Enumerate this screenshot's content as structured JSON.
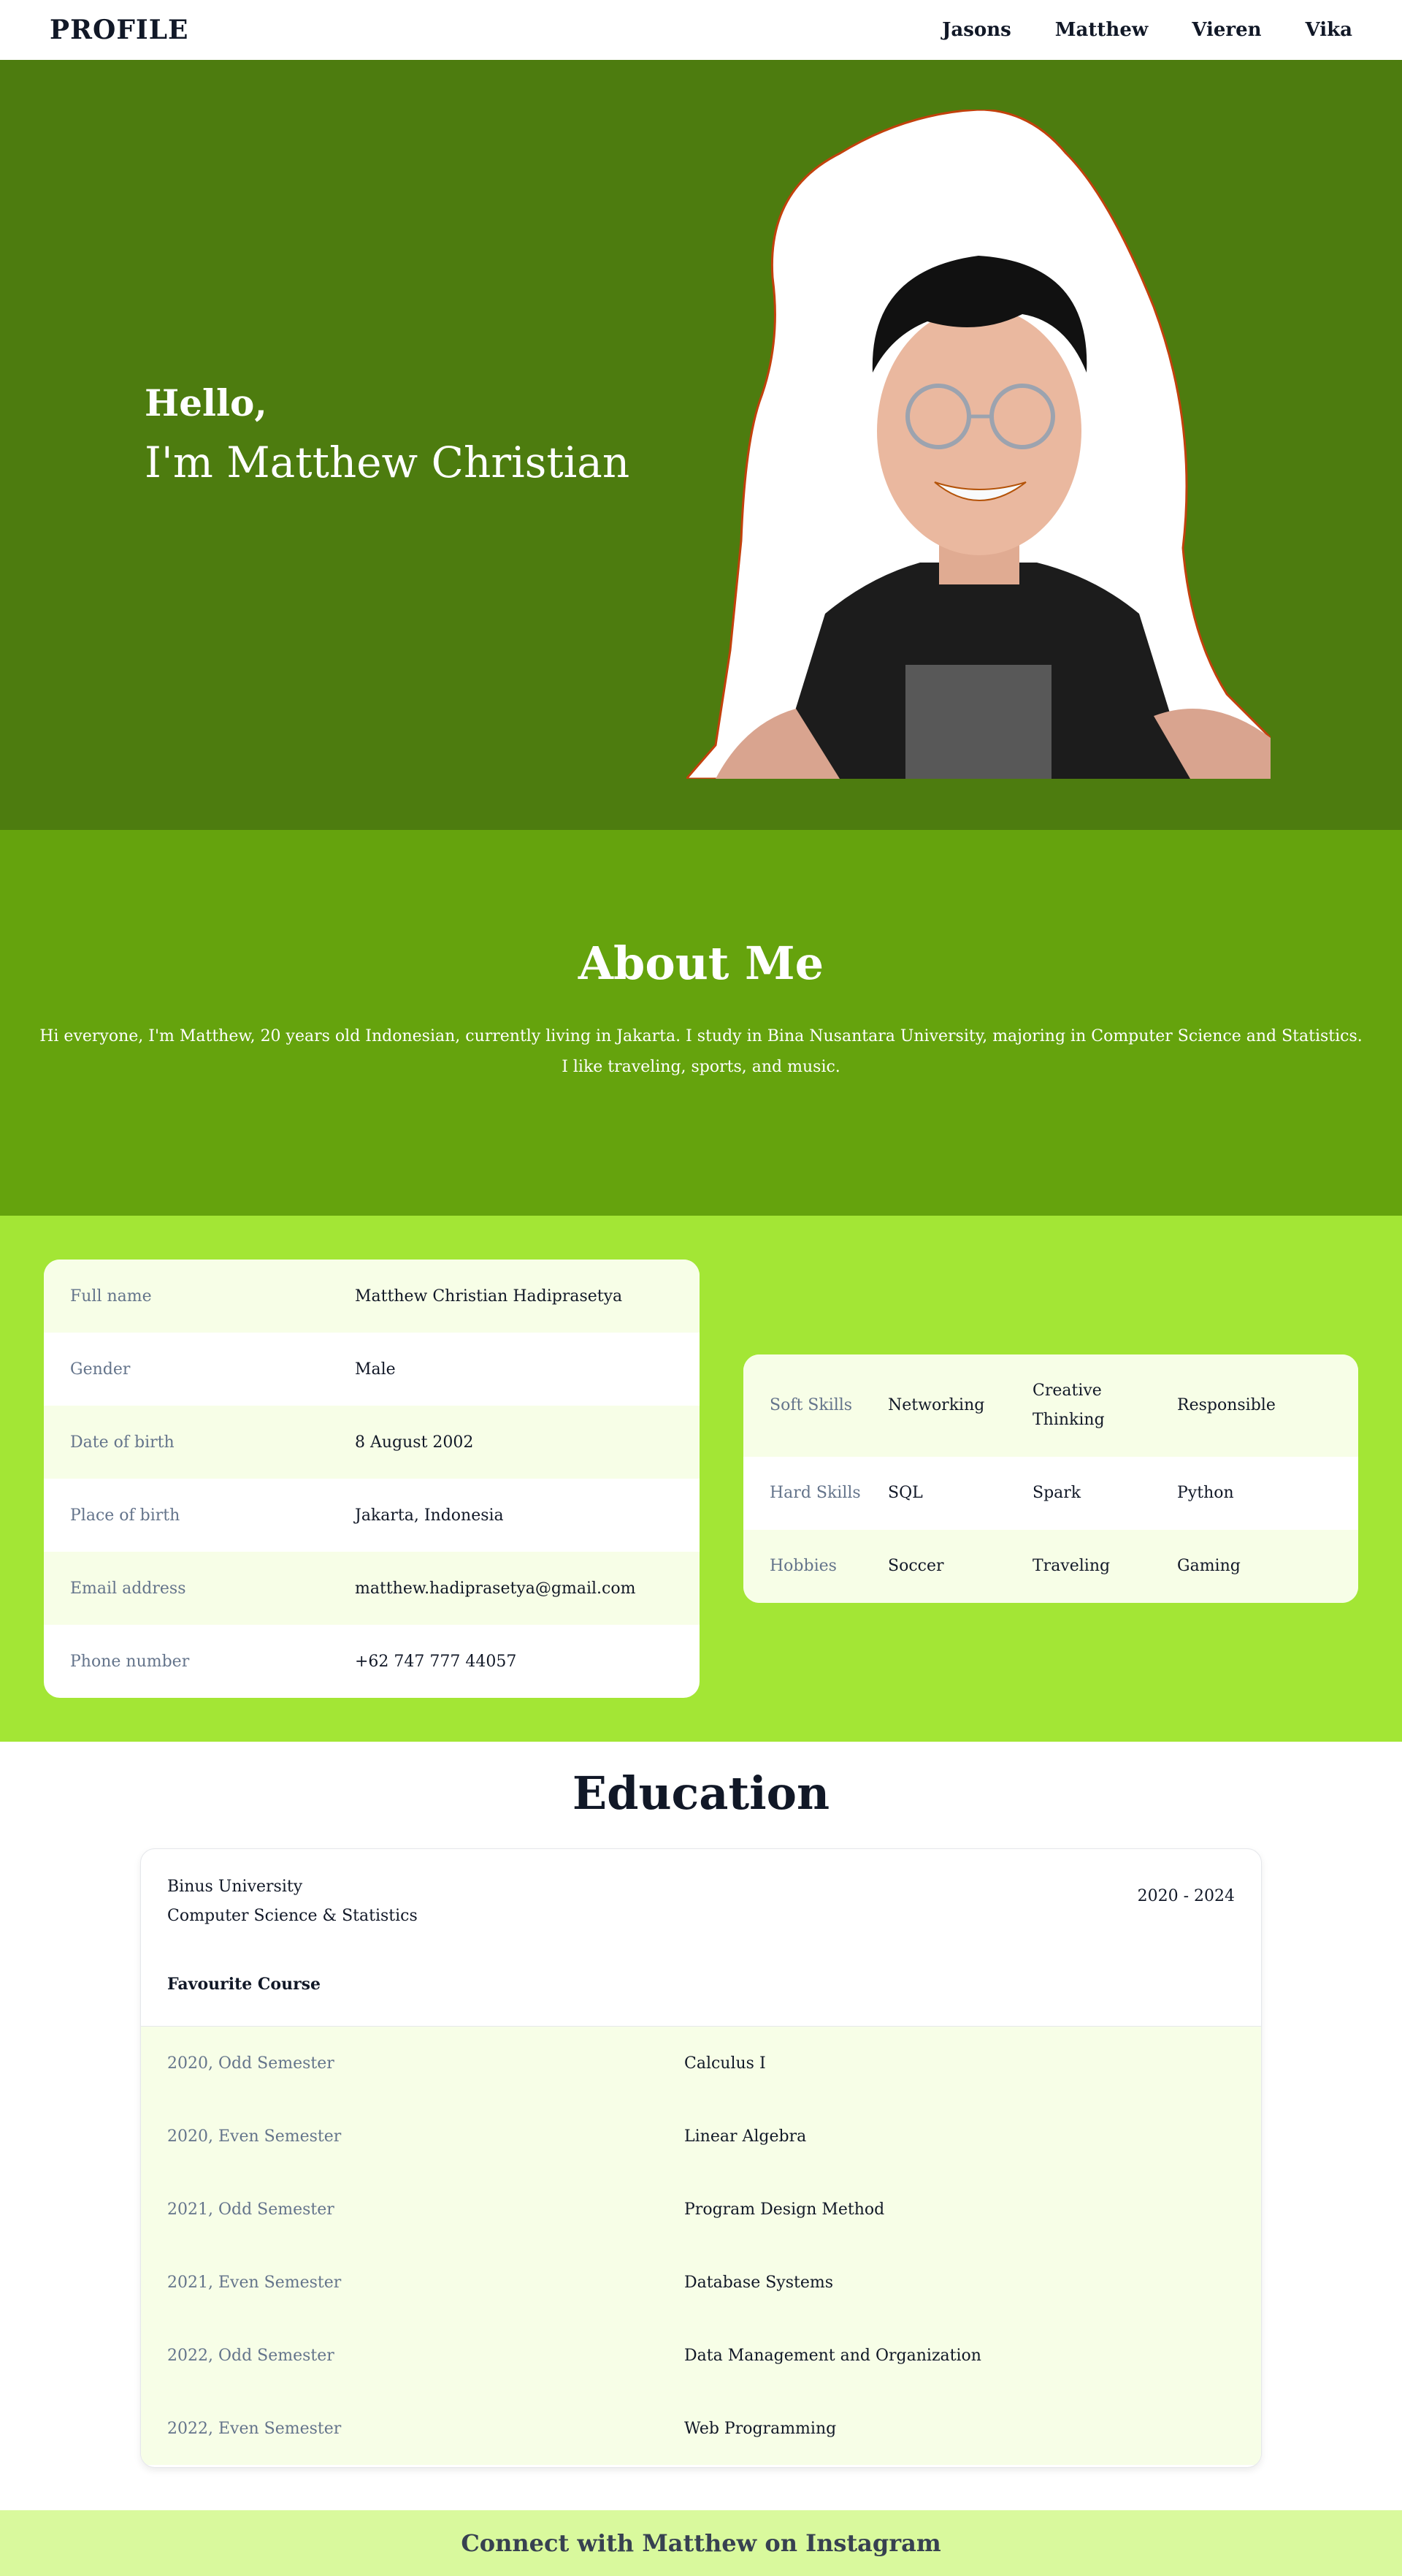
{
  "header": {
    "brand": "PROFILE",
    "nav": [
      "Jasons",
      "Matthew",
      "Vieren",
      "Vika"
    ]
  },
  "hero": {
    "greeting": "Hello,",
    "name_line": "I'm Matthew Christian"
  },
  "about": {
    "title": "About Me",
    "text": "Hi everyone, I'm Matthew, 20 years old Indonesian, currently living in Jakarta. I study in Bina Nusantara University, majoring in Computer Science and Statistics. I like traveling, sports, and music."
  },
  "personal": [
    {
      "label": "Full name",
      "value": "Matthew Christian Hadiprasetya"
    },
    {
      "label": "Gender",
      "value": "Male"
    },
    {
      "label": "Date of birth",
      "value": "8 August 2002"
    },
    {
      "label": "Place of birth",
      "value": "Jakarta, Indonesia"
    },
    {
      "label": "Email address",
      "value": "matthew.hadiprasetya@gmail.com"
    },
    {
      "label": "Phone number",
      "value": "+62 747 777 44057"
    }
  ],
  "skills": [
    {
      "label": "Soft Skills",
      "items": [
        "Networking",
        "Creative Thinking",
        "Responsible"
      ]
    },
    {
      "label": "Hard Skills",
      "items": [
        "SQL",
        "Spark",
        "Python"
      ]
    },
    {
      "label": "Hobbies",
      "items": [
        "Soccer",
        "Traveling",
        "Gaming"
      ]
    }
  ],
  "education": {
    "title": "Education",
    "school": "Binus University",
    "major": "Computer Science & Statistics",
    "years": "2020 - 2024",
    "favourite_title": "Favourite Course",
    "courses": [
      {
        "semester": "2020, Odd Semester",
        "course": "Calculus I"
      },
      {
        "semester": "2020, Even Semester",
        "course": "Linear Algebra"
      },
      {
        "semester": "2021, Odd Semester",
        "course": "Program Design Method"
      },
      {
        "semester": "2021, Even Semester",
        "course": "Database Systems"
      },
      {
        "semester": "2022, Odd Semester",
        "course": "Data Management and Organization"
      },
      {
        "semester": "2022, Even Semester",
        "course": "Web Programming"
      }
    ]
  },
  "footer": {
    "link_text": "Connect with Matthew on Instagram"
  },
  "colors": {
    "hero_bg": "#4d7c0f",
    "about_bg": "#65a30d",
    "info_bg": "#a3e635",
    "footer_bg": "#d9f99d",
    "row_alt": "#f7fee7",
    "blob_outline": "#c2410c"
  }
}
